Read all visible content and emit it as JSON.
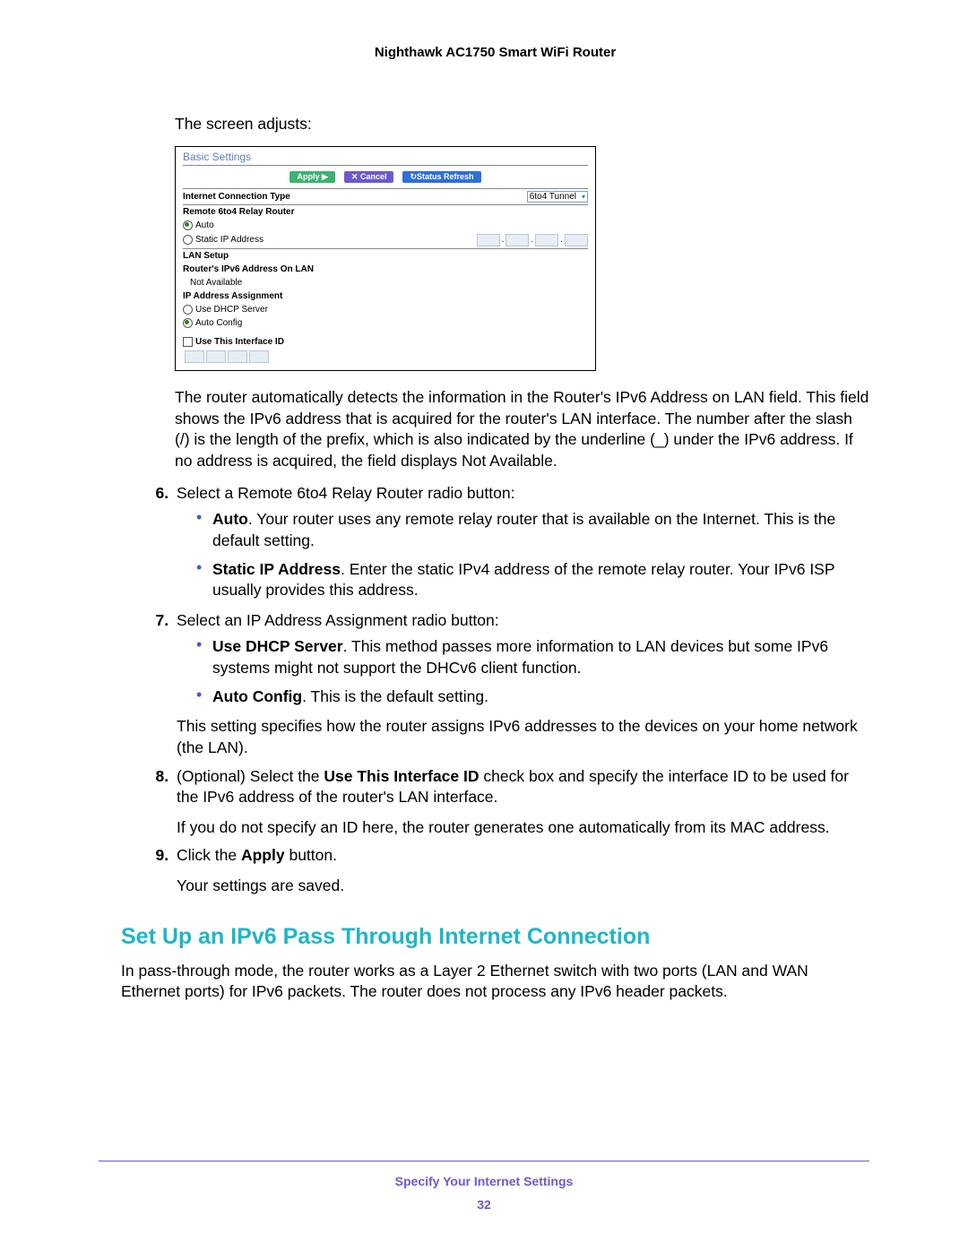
{
  "header": {
    "title": "Nighthawk AC1750 Smart WiFi Router"
  },
  "intro": "The screen adjusts:",
  "screenshot": {
    "title": "Basic Settings",
    "buttons": {
      "apply": "Apply ▶",
      "cancel": "✕ Cancel",
      "refresh": "↻Status Refresh"
    },
    "conn_type_label": "Internet Connection Type",
    "conn_type_value": "6to4 Tunnel",
    "relay_label": "Remote 6to4 Relay Router",
    "relay_auto": "Auto",
    "relay_static": "Static IP Address",
    "lan_setup": "LAN Setup",
    "lan_addr_label": "Router's IPv6 Address On LAN",
    "lan_addr_value": "Not Available",
    "ip_assign_label": "IP Address Assignment",
    "ip_dhcp": "Use DHCP Server",
    "ip_auto": "Auto Config",
    "use_iface": "Use This Interface ID"
  },
  "para_after_ss": "The router automatically detects the information in the Router's IPv6 Address on LAN field. This field shows the IPv6 address that is acquired for the router's LAN interface. The number after the slash (/) is the length of the prefix, which is also indicated by the underline (_) under the IPv6 address. If no address is acquired, the field displays Not Available.",
  "step6": {
    "lead": "Select a Remote 6to4 Relay Router radio button:",
    "auto_b": "Auto",
    "auto_t": ". Your router uses any remote relay router that is available on the Internet. This is the default setting.",
    "static_b": "Static IP Address",
    "static_t": ". Enter the static IPv4 address of the remote relay router. Your IPv6 ISP usually provides this address."
  },
  "step7": {
    "lead": "Select an IP Address Assignment radio button:",
    "dhcp_b": "Use DHCP Server",
    "dhcp_t": ". This method passes more information to LAN devices but some IPv6 systems might not support the DHCv6 client function.",
    "auto_b": "Auto Config",
    "auto_t": ". This is the default setting.",
    "tail": "This setting specifies how the router assigns IPv6 addresses to the devices on your home network (the LAN)."
  },
  "step8": {
    "pre": "(Optional) Select the ",
    "bold": "Use This Interface ID",
    "post": " check box and specify the interface ID to be used for the IPv6 address of the router's LAN interface.",
    "tail": "If you do not specify an ID here, the router generates one automatically from its MAC address."
  },
  "step9": {
    "pre": "Click the ",
    "bold": "Apply",
    "post": " button.",
    "tail": "Your settings are saved."
  },
  "section": {
    "heading": "Set Up an IPv6 Pass Through Internet Connection",
    "text": "In pass-through mode, the router works as a Layer 2 Ethernet switch with two ports (LAN and WAN Ethernet ports) for IPv6 packets. The router does not process any IPv6 header packets."
  },
  "footer": {
    "title": "Specify Your Internet Settings",
    "page": "32"
  }
}
